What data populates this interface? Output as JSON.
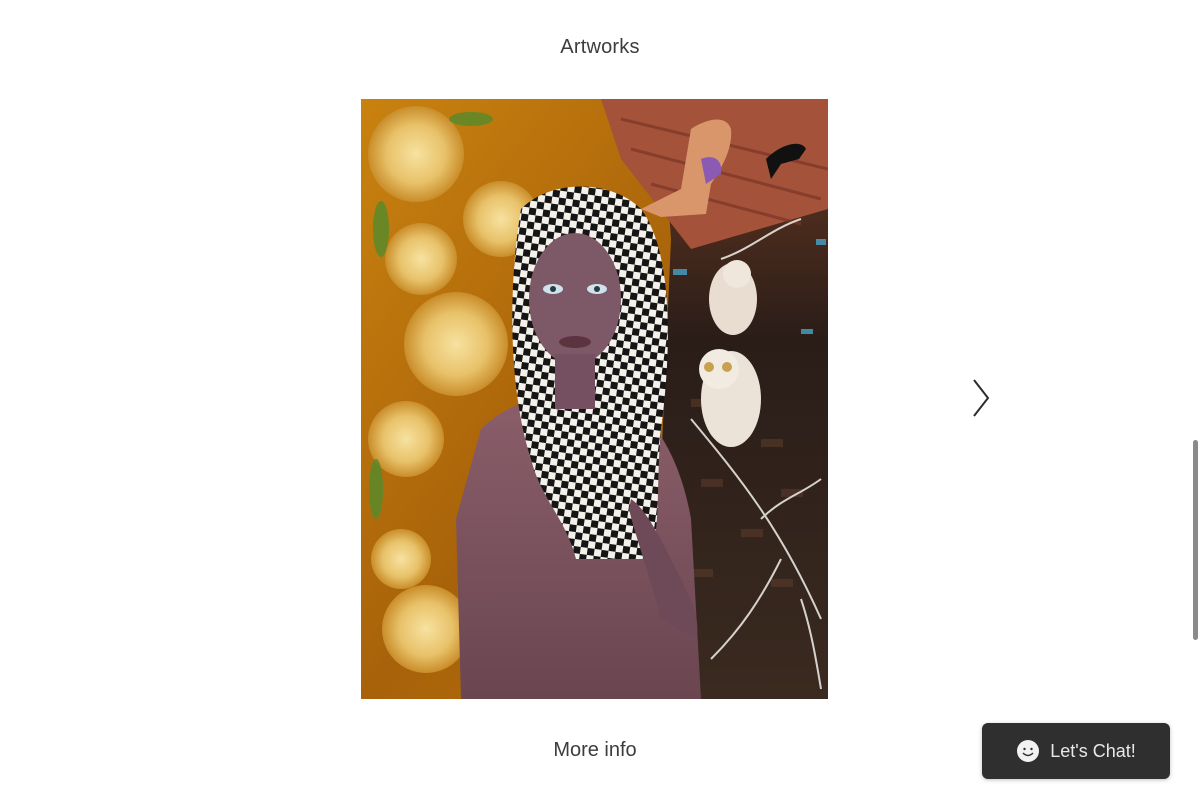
{
  "section": {
    "title": "Artworks"
  },
  "gallery": {
    "image_alt": "Artwork painting",
    "next_icon": "chevron-right-icon"
  },
  "links": {
    "more_info": "More info"
  },
  "chat": {
    "label": "Let's Chat!",
    "icon": "smiley-chat-icon",
    "background": "#2f2f2f"
  }
}
